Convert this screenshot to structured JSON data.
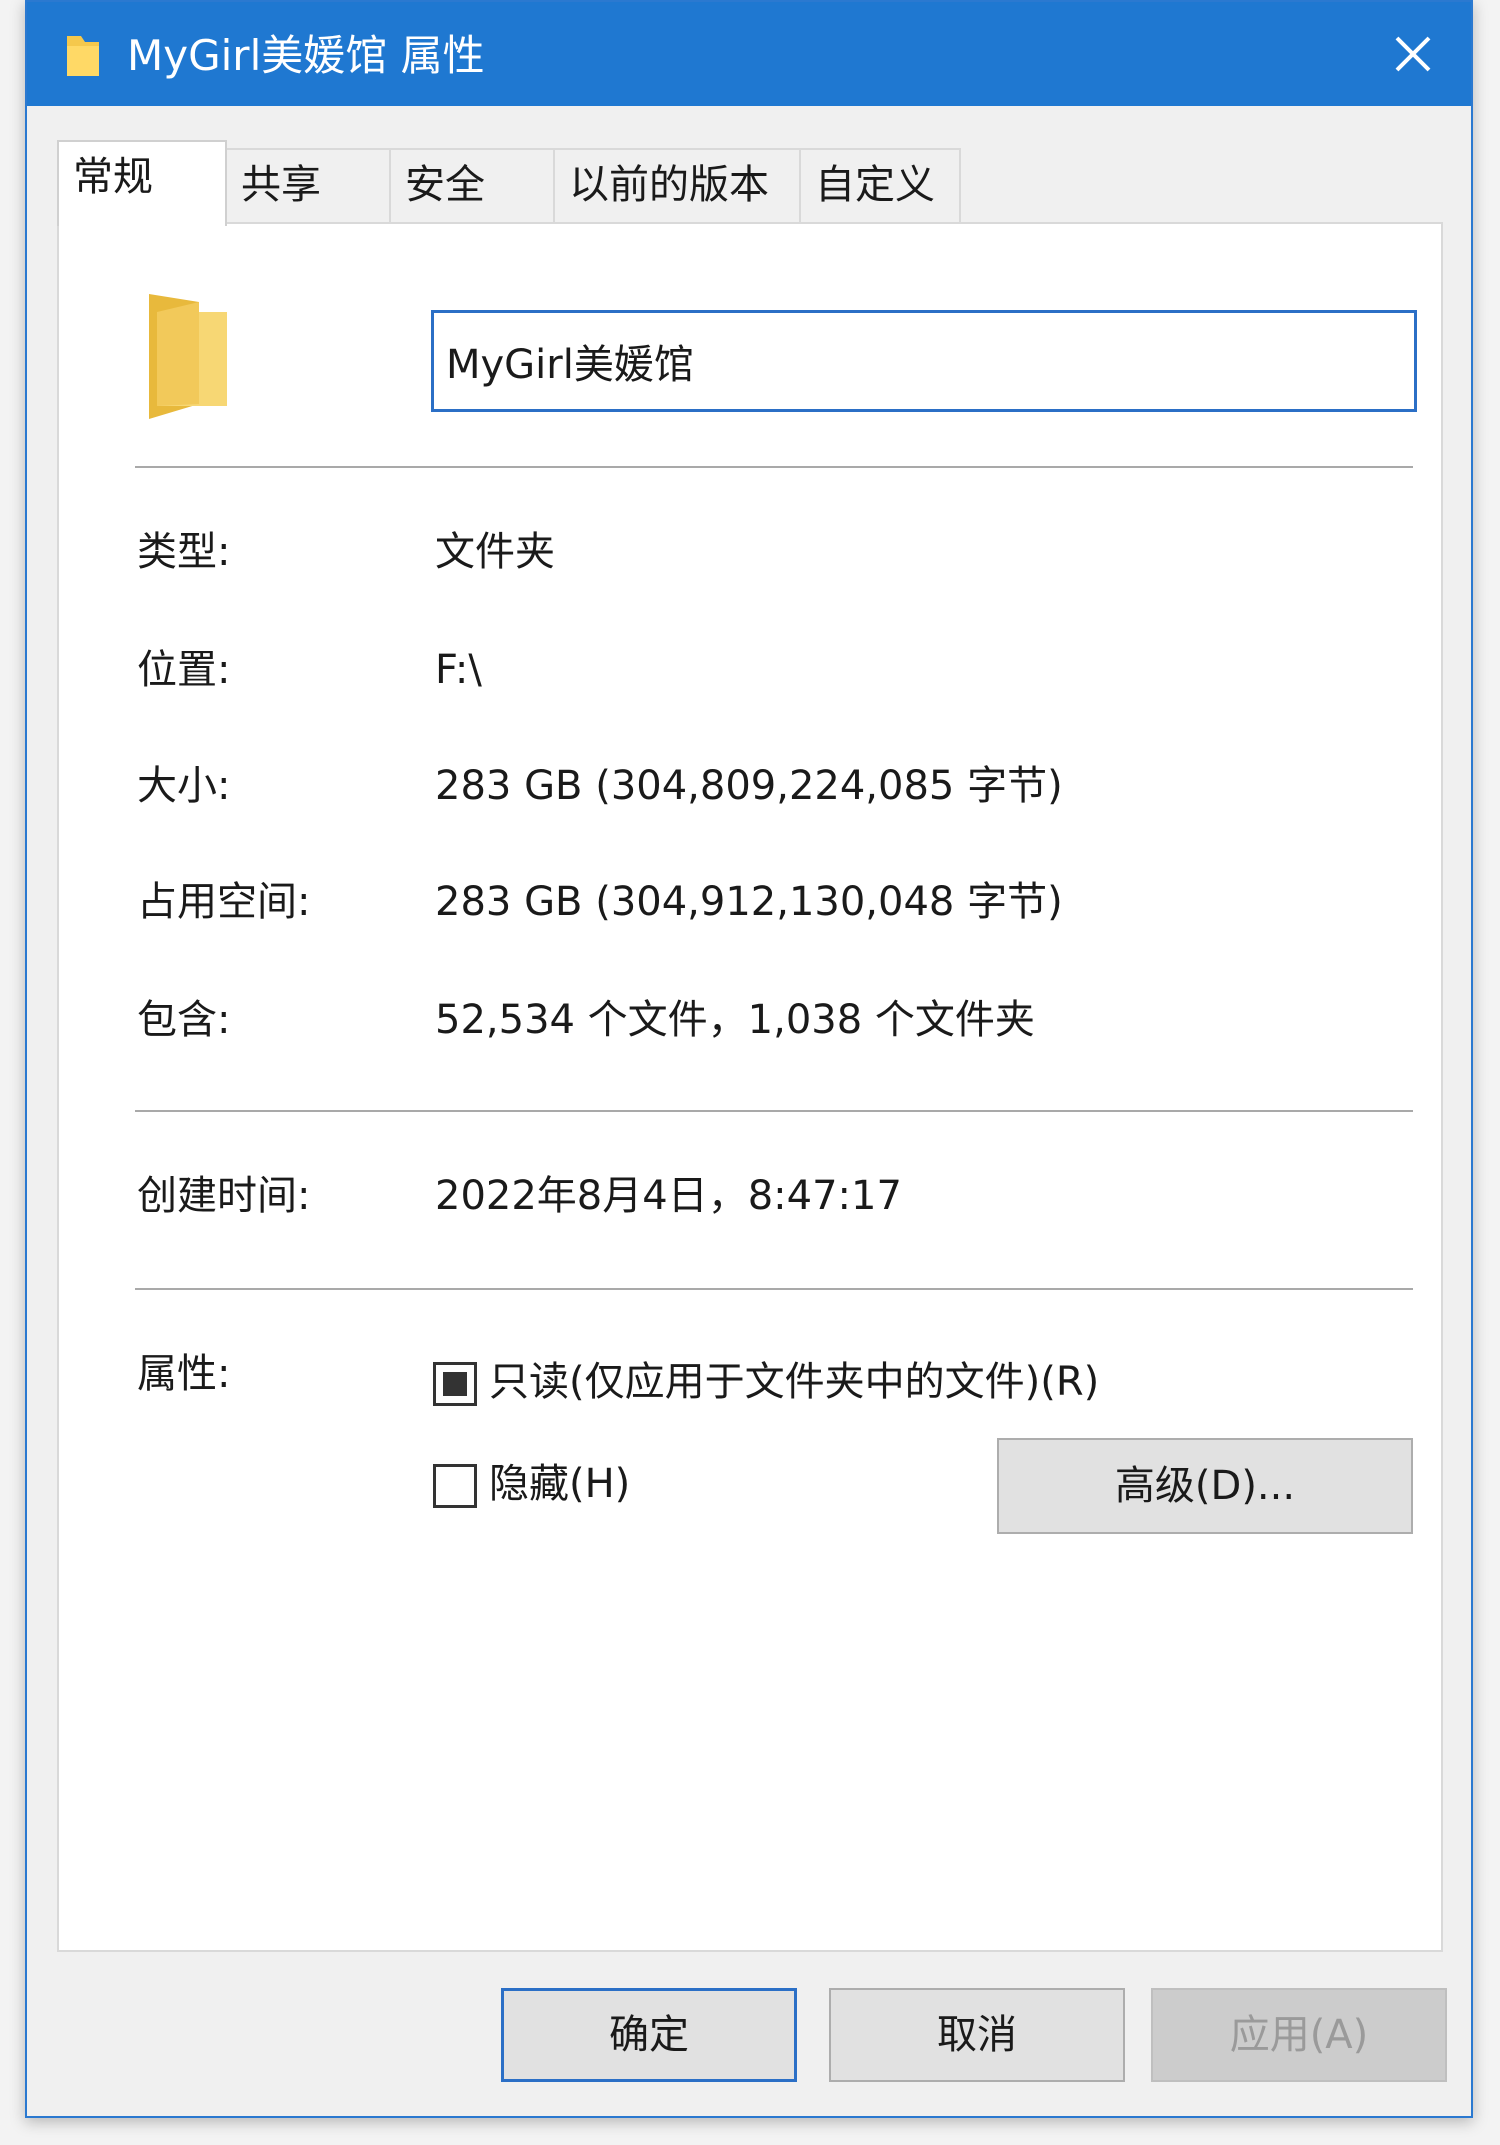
{
  "window": {
    "title": "MyGirl美媛馆 属性"
  },
  "tabs": [
    {
      "label": "常规",
      "active": true
    },
    {
      "label": "共享",
      "active": false
    },
    {
      "label": "安全",
      "active": false
    },
    {
      "label": "以前的版本",
      "active": false
    },
    {
      "label": "自定义",
      "active": false
    }
  ],
  "general": {
    "name_value": "MyGirl美媛馆",
    "type_label": "类型:",
    "type_value": "文件夹",
    "location_label": "位置:",
    "location_value": "F:\\",
    "size_label": "大小:",
    "size_value": "283 GB (304,809,224,085 字节)",
    "disk_size_label": "占用空间:",
    "disk_size_value": "283 GB (304,912,130,048 字节)",
    "contains_label": "包含:",
    "contains_value": "52,534 个文件，1,038 个文件夹",
    "created_label": "创建时间:",
    "created_value": "2022年8月4日，8:47:17",
    "attributes_label": "属性:",
    "readonly_label": "只读(仅应用于文件夹中的文件)(R)",
    "readonly_state": "indeterminate",
    "hidden_label": "隐藏(H)",
    "hidden_state": "unchecked",
    "advanced_button": "高级(D)..."
  },
  "footer": {
    "ok_label": "确定",
    "cancel_label": "取消",
    "apply_label": "应用(A)"
  },
  "colors": {
    "titlebar": "#1f78d1",
    "focus_border": "#2b6fc6",
    "folder_yellow": "#f7d774"
  },
  "icons": {
    "title_icon": "folder-icon",
    "close_icon": "close-icon",
    "big_icon": "folder-icon"
  }
}
